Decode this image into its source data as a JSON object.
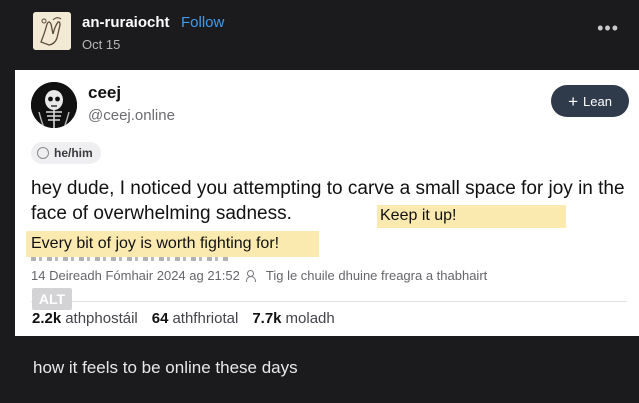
{
  "post": {
    "username": "an-ruraiocht",
    "follow_label": "Follow",
    "date": "Oct 15",
    "more_label": "•••",
    "caption": "how it feels to be online these days"
  },
  "embed": {
    "display_name": "ceej",
    "handle": "@ceej.online",
    "follow_button_label": "Lean",
    "pronouns": "he/him",
    "text": "hey dude, I noticed you attempting to carve a small space for joy in the face of overwhelming sadness.",
    "highlight_1": "Keep it up!",
    "highlight_2": "Every bit of joy is worth fighting for!",
    "timestamp": "14 Deireadh Fómhair 2024 ag 21:52",
    "reply_setting": "Tig le chuile dhuine freagra a thabhairt",
    "alt_badge": "ALT",
    "stats": [
      {
        "count": "2.2k",
        "label": "athphostáil"
      },
      {
        "count": "64",
        "label": "athfhriotal"
      },
      {
        "count": "7.7k",
        "label": "moladh"
      }
    ]
  },
  "colors": {
    "background": "#1b1b1d",
    "link": "#3f9bf0",
    "highlight": "#fbeab0",
    "button": "#2f3a4a"
  },
  "icons": [
    "avatar-hand-illustration",
    "avatar-skeleton",
    "plus-icon",
    "pronoun-icon",
    "people-icon"
  ]
}
